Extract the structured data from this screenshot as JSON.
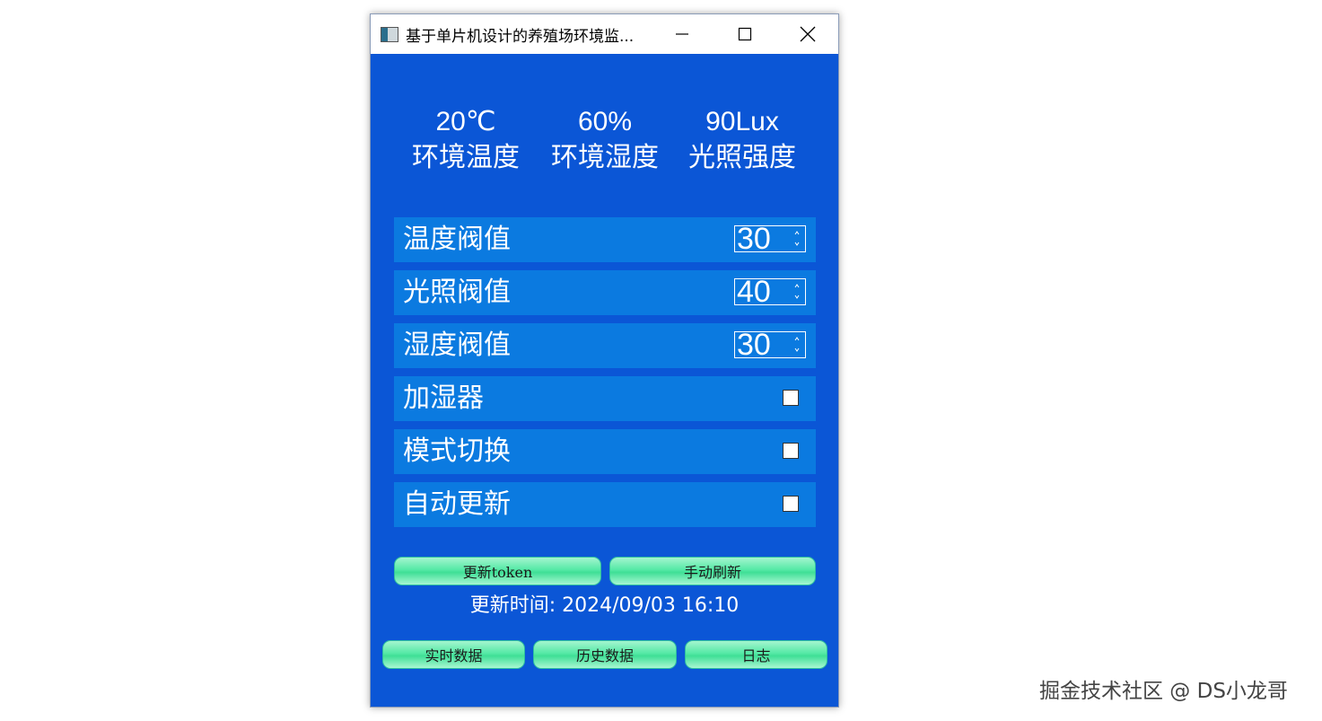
{
  "window": {
    "title": "基于单片机设计的养殖场环境监..."
  },
  "sensors": [
    {
      "value": "20℃",
      "label": "环境温度"
    },
    {
      "value": "60%",
      "label": "环境湿度"
    },
    {
      "value": "90Lux",
      "label": "光照强度"
    }
  ],
  "settings": {
    "temp_threshold": {
      "label": "温度阀值",
      "value": "30"
    },
    "light_threshold": {
      "label": "光照阀值",
      "value": "40"
    },
    "humidity_threshold": {
      "label": "湿度阀值",
      "value": "30"
    },
    "humidifier": {
      "label": "加湿器",
      "checked": false
    },
    "mode_switch": {
      "label": "模式切换",
      "checked": false
    },
    "auto_update": {
      "label": "自动更新",
      "checked": false
    }
  },
  "actions": {
    "update_token": "更新token",
    "manual_refresh": "手动刷新"
  },
  "status": {
    "update_time": "更新时间: 2024/09/03 16:10"
  },
  "nav": {
    "realtime": "实时数据",
    "history": "历史数据",
    "log": "日志"
  },
  "watermark": "掘金技术社区 @ DS小龙哥",
  "colors": {
    "background": "#0b56d6",
    "row": "#0b7ae0",
    "button": "#55e9a6"
  }
}
